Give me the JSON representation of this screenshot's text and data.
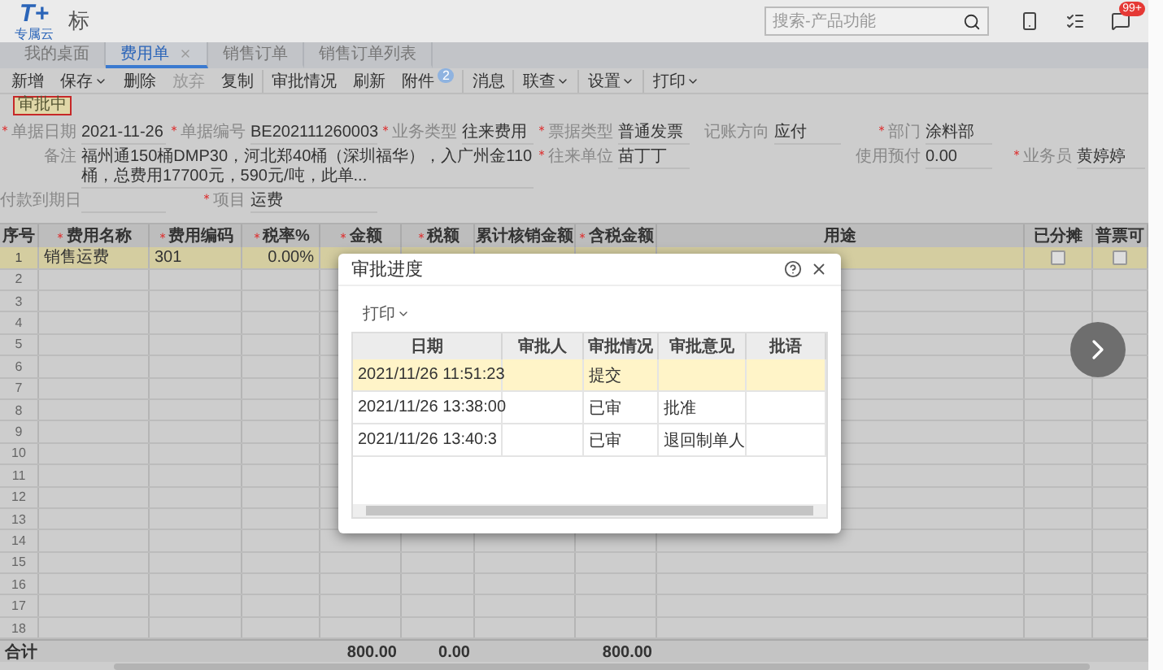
{
  "header": {
    "logo": "T+",
    "logo_sub": "专属云",
    "app_name": "标",
    "search": {
      "placeholder": "搜索-产品功能"
    },
    "notification_badge": "99+"
  },
  "tabs": [
    {
      "label": "我的桌面",
      "selected": false,
      "closable": false
    },
    {
      "label": "费用单",
      "selected": true,
      "closable": true
    },
    {
      "label": "销售订单",
      "selected": false,
      "closable": false
    },
    {
      "label": "销售订单列表",
      "selected": false,
      "closable": false
    }
  ],
  "toolbar": [
    {
      "label": "新增",
      "dropdown": false,
      "disabled": false
    },
    {
      "label": "保存",
      "dropdown": true,
      "disabled": false
    },
    {
      "label": "删除",
      "dropdown": false,
      "disabled": false
    },
    {
      "label": "放弃",
      "dropdown": false,
      "disabled": true
    },
    {
      "label": "复制",
      "dropdown": false,
      "disabled": false
    },
    {
      "label": "审批情况",
      "dropdown": false,
      "disabled": false
    },
    {
      "label": "刷新",
      "dropdown": false,
      "disabled": false
    },
    {
      "label": "附件",
      "dropdown": false,
      "disabled": false,
      "badge": "2"
    },
    {
      "label": "消息",
      "dropdown": false,
      "disabled": false
    },
    {
      "label": "联查",
      "dropdown": true,
      "disabled": false
    },
    {
      "label": "设置",
      "dropdown": true,
      "disabled": false
    },
    {
      "label": "打印",
      "dropdown": true,
      "disabled": false
    }
  ],
  "status": "审批中",
  "form": [
    [
      {
        "label": "单据日期",
        "required": true,
        "value": "2021-11-26"
      },
      {
        "label": "单据编号",
        "required": true,
        "value": "BE202111260003"
      },
      {
        "label": "业务类型",
        "required": true,
        "value": "往来费用"
      },
      {
        "label": "票据类型",
        "required": true,
        "value": "普通发票"
      },
      {
        "label": "记账方向",
        "required": false,
        "value": "应付"
      },
      {
        "label": "部门",
        "required": true,
        "value": "涂料部"
      }
    ],
    [
      {
        "label": "备注",
        "required": false,
        "value": "福州通150桶DMP30，河北郑40桶（深圳福华），入广州金110桶，总费用17700元，590元/吨，此单..."
      },
      {
        "label": "往来单位",
        "required": true,
        "value": "苗丁丁"
      },
      {
        "label": "使用预付",
        "required": false,
        "value": "0.00"
      },
      {
        "label": "业务员",
        "required": true,
        "value": "黄婷婷"
      }
    ],
    [
      {
        "label": "付款到期日",
        "required": false
      },
      {
        "label": "项目",
        "required": true,
        "value": "运费"
      }
    ]
  ],
  "table": {
    "columns": [
      {
        "label": "序号",
        "required": false
      },
      {
        "label": "费用名称",
        "required": true
      },
      {
        "label": "费用编码",
        "required": true
      },
      {
        "label": "税率%",
        "required": true
      },
      {
        "label": "金额",
        "required": true
      },
      {
        "label": "税额",
        "required": true
      },
      {
        "label": "累计核销金额",
        "required": false
      },
      {
        "label": "含税金额",
        "required": true
      },
      {
        "label": "用途",
        "required": false
      },
      {
        "label": "已分摊",
        "required": false
      },
      {
        "label": "普票可",
        "required": false
      }
    ],
    "rows": [
      {
        "number": "1",
        "name": "销售运费",
        "code": "301",
        "tax_rate": "0.00%",
        "allocated": false,
        "invoice": false,
        "selected": true
      },
      {
        "number": "2",
        "selected": false
      },
      {
        "number": "3",
        "selected": false
      },
      {
        "number": "4",
        "selected": false
      },
      {
        "number": "5",
        "selected": false
      },
      {
        "number": "6",
        "selected": false
      },
      {
        "number": "7",
        "selected": false
      },
      {
        "number": "8",
        "selected": false
      },
      {
        "number": "9",
        "selected": false
      },
      {
        "number": "10",
        "selected": false
      },
      {
        "number": "11",
        "selected": false
      },
      {
        "number": "12",
        "selected": false
      },
      {
        "number": "13",
        "selected": false
      },
      {
        "number": "14",
        "selected": false
      },
      {
        "number": "15",
        "selected": false
      },
      {
        "number": "16",
        "selected": false
      },
      {
        "number": "17",
        "selected": false
      },
      {
        "number": "18",
        "selected": false
      }
    ],
    "footer": {
      "label": "合计",
      "amount": "800.00",
      "tax": "0.00",
      "total": "800.00"
    }
  },
  "dialog": {
    "title": "审批进度",
    "print": "打印",
    "columns": [
      "日期",
      "审批人",
      "审批情况",
      "审批意见",
      "批语"
    ],
    "rows": [
      {
        "date": "2021/11/26 11:51:23",
        "status": "提交",
        "selected": true
      },
      {
        "date": "2021/11/26 13:38:00",
        "status": "已审",
        "opinion": "批准",
        "selected": false
      },
      {
        "date": "2021/11/26 13:40:3",
        "status": "已审",
        "opinion": "退回制单人",
        "selected": false
      }
    ]
  }
}
